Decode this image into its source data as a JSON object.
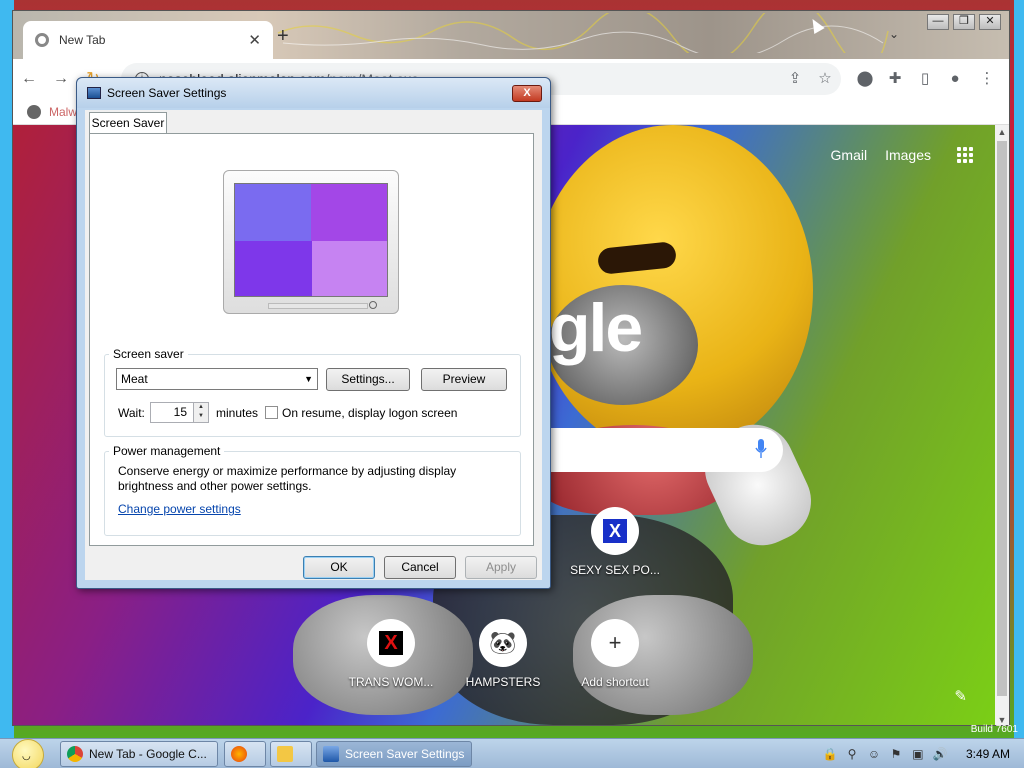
{
  "browser": {
    "tab_title": "New Tab",
    "new_tab_symbol": "+",
    "url_domain": "nosebleed.alienmelon.com",
    "url_path": "/porn/Meat.exe",
    "bookmark_label": "Malw",
    "ntp": {
      "gmail": "Gmail",
      "images": "Images",
      "logo_partial": "gle",
      "shortcuts": [
        {
          "label": "SEXY SEX PO...",
          "glyph": "X"
        },
        {
          "label": "TRANS WOM...",
          "glyph": "X"
        },
        {
          "label": "HAMPSTERS",
          "glyph": "🐼"
        },
        {
          "label": "Add shortcut",
          "glyph": "+"
        }
      ]
    },
    "window_controls": [
      "—",
      "❐",
      "✕"
    ]
  },
  "dialog": {
    "title": "Screen Saver Settings",
    "tab": "Screen Saver",
    "screen_saver_group": "Screen saver",
    "selected_saver": "Meat",
    "settings_btn": "Settings...",
    "preview_btn": "Preview",
    "wait_label": "Wait:",
    "wait_value": "15",
    "minutes_label": "minutes",
    "resume_label": "On resume, display logon screen",
    "resume_checked": false,
    "power_group": "Power management",
    "power_text": "Conserve energy or maximize performance by adjusting display brightness and other power settings.",
    "power_link": "Change power settings",
    "ok": "OK",
    "cancel": "Cancel",
    "apply": "Apply",
    "close": "X"
  },
  "taskbar": {
    "tasks": [
      {
        "label": "New Tab - Google C...",
        "icon": "chrome-icon",
        "active": false
      },
      {
        "label": "",
        "icon": "firefox-icon",
        "active": false
      },
      {
        "label": "",
        "icon": "folder-icon",
        "active": false
      },
      {
        "label": "Screen Saver Settings",
        "icon": "monitor-icon",
        "active": true
      }
    ],
    "clock": "3:49 AM",
    "build": "Build 7601"
  },
  "colors": {
    "taskbar": "#bdd4ea",
    "dialog_frame": "#bcd5ee",
    "link": "#0645ad"
  }
}
